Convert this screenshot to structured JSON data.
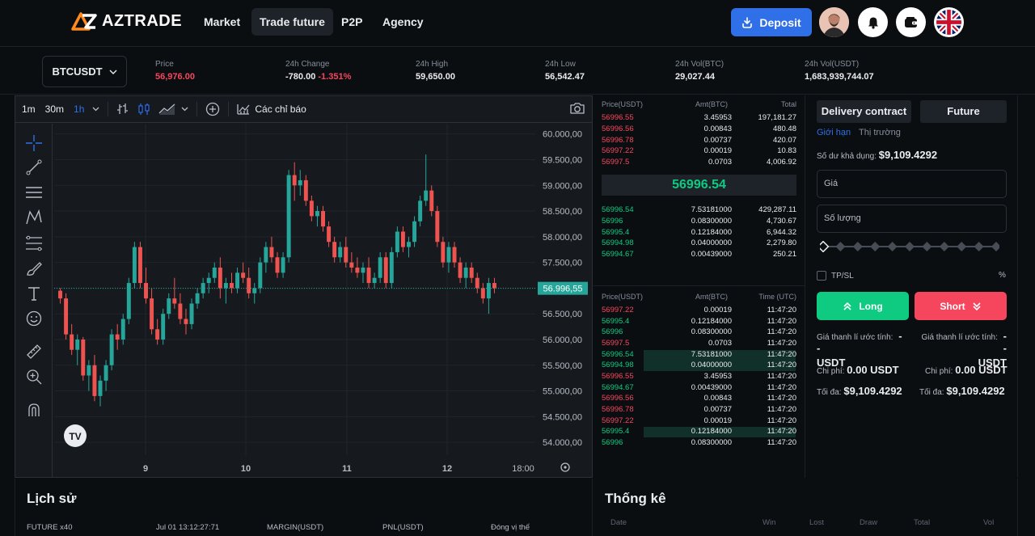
{
  "brand": {
    "name": "AZTRADE"
  },
  "nav": [
    {
      "label": "Market",
      "active": false
    },
    {
      "label": "Trade future",
      "active": true
    },
    {
      "label": "P2P",
      "active": false
    },
    {
      "label": "Agency",
      "active": false
    }
  ],
  "header": {
    "deposit_label": "Deposit",
    "icons": [
      "avatar",
      "bell-icon",
      "wallet-icon",
      "uk-flag-icon"
    ]
  },
  "ticker": {
    "pair": "BTCUSDT",
    "stats": [
      {
        "label": "Price",
        "value": "56,976.00",
        "value_extra": "",
        "color": "red"
      },
      {
        "label": "24h Change",
        "value": "-780.00",
        "value_extra": "-1.351%",
        "color": "white"
      },
      {
        "label": "24h High",
        "value": "59,650.00",
        "value_extra": "",
        "color": "white"
      },
      {
        "label": "24h Low",
        "value": "56,542.47",
        "value_extra": "",
        "color": "white"
      },
      {
        "label": "24h Vol(BTC)",
        "value": "29,027.44",
        "value_extra": "",
        "color": "white"
      },
      {
        "label": "24h Vol(USDT)",
        "value": "1,683,939,744.07",
        "value_extra": "",
        "color": "white"
      }
    ]
  },
  "chart_toolbar": {
    "timeframes": [
      "1m",
      "30m",
      "1h"
    ],
    "active_timeframe": "1h",
    "indicators_label": "Các chỉ báo"
  },
  "chart_data": {
    "type": "candlestick",
    "y_ticks": [
      "60.000,00",
      "59.500,00",
      "59.000,00",
      "58.500,00",
      "58.000,00",
      "57.500,00",
      "57.000,00",
      "56.500,00",
      "56.000,00",
      "55.500,00",
      "55.000,00",
      "54.500,00",
      "54.000,00"
    ],
    "x_ticks": [
      "9",
      "10",
      "11",
      "12",
      "18:00"
    ],
    "ylim": [
      53750,
      60200
    ],
    "last_price_label": "56.996,55",
    "last_price": 56996.55,
    "up_color": "#26a69a",
    "down_color": "#ef5350",
    "candles_ohlc": [
      [
        56950,
        57000,
        56700,
        56800
      ],
      [
        56800,
        56900,
        56000,
        56100
      ],
      [
        56100,
        56300,
        55700,
        55800
      ],
      [
        55800,
        56100,
        55500,
        56000
      ],
      [
        56000,
        56050,
        55200,
        55300
      ],
      [
        55300,
        55600,
        55000,
        55500
      ],
      [
        55500,
        55700,
        54800,
        54900
      ],
      [
        54900,
        55300,
        54700,
        55200
      ],
      [
        55200,
        55600,
        55000,
        55500
      ],
      [
        55500,
        56200,
        55400,
        56100
      ],
      [
        56100,
        56300,
        55800,
        56000
      ],
      [
        56000,
        56500,
        55900,
        56400
      ],
      [
        56400,
        57200,
        56300,
        57100
      ],
      [
        57100,
        57900,
        57000,
        57800
      ],
      [
        57800,
        57900,
        57000,
        57100
      ],
      [
        57100,
        57400,
        56700,
        56800
      ],
      [
        56800,
        57000,
        56100,
        56200
      ],
      [
        56200,
        56400,
        55900,
        56000
      ],
      [
        56000,
        56600,
        55900,
        56500
      ],
      [
        56500,
        56900,
        56400,
        56800
      ],
      [
        56800,
        57200,
        56600,
        56700
      ],
      [
        56700,
        56900,
        56300,
        56400
      ],
      [
        56400,
        56600,
        56100,
        56300
      ],
      [
        56300,
        56800,
        56200,
        56700
      ],
      [
        56700,
        57000,
        56600,
        56900
      ],
      [
        56900,
        57200,
        56800,
        57100
      ],
      [
        57100,
        57300,
        56900,
        57200
      ],
      [
        57200,
        57500,
        57100,
        57400
      ],
      [
        57400,
        57600,
        56800,
        57000
      ],
      [
        57000,
        57200,
        56700,
        57100
      ],
      [
        57100,
        57300,
        56900,
        57000
      ],
      [
        57000,
        57400,
        56900,
        57300
      ],
      [
        57300,
        57500,
        57100,
        57200
      ],
      [
        57200,
        57400,
        56800,
        56900
      ],
      [
        56900,
        57100,
        56700,
        57000
      ],
      [
        57000,
        57600,
        56900,
        57500
      ],
      [
        57500,
        57900,
        57300,
        57800
      ],
      [
        57800,
        58000,
        57500,
        57600
      ],
      [
        57600,
        57700,
        57200,
        57300
      ],
      [
        57300,
        57700,
        57200,
        57600
      ],
      [
        57600,
        59300,
        57500,
        59200
      ],
      [
        59200,
        59450,
        58700,
        59000
      ],
      [
        59000,
        59300,
        58800,
        59100
      ],
      [
        59100,
        59200,
        58600,
        58700
      ],
      [
        58700,
        58800,
        58300,
        58400
      ],
      [
        58400,
        58600,
        58200,
        58500
      ],
      [
        58500,
        58600,
        58100,
        58200
      ],
      [
        58200,
        58300,
        57800,
        57900
      ],
      [
        57900,
        58000,
        57500,
        57600
      ],
      [
        57600,
        57900,
        57500,
        57800
      ],
      [
        57800,
        58000,
        57400,
        57500
      ],
      [
        57500,
        57700,
        57300,
        57400
      ],
      [
        57400,
        57600,
        57200,
        57300
      ],
      [
        57300,
        57500,
        57100,
        57400
      ],
      [
        57400,
        57600,
        57000,
        57100
      ],
      [
        57100,
        57300,
        57000,
        57200
      ],
      [
        57200,
        57700,
        57100,
        57600
      ],
      [
        57600,
        57700,
        57000,
        57100
      ],
      [
        57100,
        57800,
        57000,
        57700
      ],
      [
        57700,
        58200,
        57600,
        58100
      ],
      [
        58100,
        58200,
        57700,
        57800
      ],
      [
        57800,
        58000,
        57600,
        57900
      ],
      [
        57900,
        58400,
        57800,
        58300
      ],
      [
        58300,
        58800,
        58200,
        58700
      ],
      [
        58700,
        59600,
        58600,
        58900
      ],
      [
        58900,
        59000,
        58400,
        58500
      ],
      [
        58500,
        58600,
        57800,
        57900
      ],
      [
        57900,
        58000,
        57400,
        57500
      ],
      [
        57500,
        57900,
        57300,
        57800
      ],
      [
        57800,
        57900,
        57400,
        57500
      ],
      [
        57500,
        57600,
        57100,
        57200
      ],
      [
        57200,
        57500,
        57000,
        57400
      ],
      [
        57400,
        57500,
        57100,
        57200
      ],
      [
        57200,
        57300,
        56900,
        57000
      ],
      [
        57000,
        57100,
        56700,
        56800
      ],
      [
        56800,
        57200,
        56500,
        57100
      ],
      [
        57100,
        57200,
        56900,
        57000
      ]
    ]
  },
  "orderbook": {
    "headers": [
      "Price(USDT)",
      "Amt(BTC)",
      "Total"
    ],
    "asks": [
      [
        "56996.55",
        "3.45953",
        "197,181.27"
      ],
      [
        "56996.56",
        "0.00843",
        "480.48"
      ],
      [
        "56996.78",
        "0.00737",
        "420.07"
      ],
      [
        "56997.22",
        "0.00019",
        "10.83"
      ],
      [
        "56997.5",
        "0.0703",
        "4,006.92"
      ]
    ],
    "mid_price": "56996.54",
    "bids": [
      [
        "56996.54",
        "7.53181000",
        "429,287.11"
      ],
      [
        "56996",
        "0.08300000",
        "4,730.67"
      ],
      [
        "56995.4",
        "0.12184000",
        "6,944.32"
      ],
      [
        "56994.98",
        "0.04000000",
        "2,279.80"
      ],
      [
        "56994.67",
        "0.00439000",
        "250.21"
      ]
    ]
  },
  "trades": {
    "headers": [
      "Price(USDT)",
      "Amt(BTC)",
      "Time (UTC)"
    ],
    "rows": [
      {
        "price": "56997.22",
        "amount": "0.00019",
        "time": "11:47:20",
        "side": "sell",
        "highlight": false
      },
      {
        "price": "56995.4",
        "amount": "0.12184000",
        "time": "11:47:20",
        "side": "buy",
        "highlight": false
      },
      {
        "price": "56996",
        "amount": "0.08300000",
        "time": "11:47:20",
        "side": "buy",
        "highlight": false
      },
      {
        "price": "56997.5",
        "amount": "0.0703",
        "time": "11:47:20",
        "side": "sell",
        "highlight": false
      },
      {
        "price": "56996.54",
        "amount": "7.53181000",
        "time": "11:47:20",
        "side": "buy",
        "highlight": true
      },
      {
        "price": "56994.98",
        "amount": "0.04000000",
        "time": "11:47:20",
        "side": "buy",
        "highlight": true
      },
      {
        "price": "56996.55",
        "amount": "3.45953",
        "time": "11:47:20",
        "side": "sell",
        "highlight": false
      },
      {
        "price": "56994.67",
        "amount": "0.00439000",
        "time": "11:47:20",
        "side": "buy",
        "highlight": false
      },
      {
        "price": "56996.56",
        "amount": "0.00843",
        "time": "11:47:20",
        "side": "sell",
        "highlight": false
      },
      {
        "price": "56996.78",
        "amount": "0.00737",
        "time": "11:47:20",
        "side": "sell",
        "highlight": false
      },
      {
        "price": "56997.22",
        "amount": "0.00019",
        "time": "11:47:20",
        "side": "sell",
        "highlight": false
      },
      {
        "price": "56995.4",
        "amount": "0.12184000",
        "time": "11:47:20",
        "side": "buy",
        "highlight": true
      },
      {
        "price": "56996",
        "amount": "0.08300000",
        "time": "11:47:20",
        "side": "buy",
        "highlight": false
      }
    ]
  },
  "trade_form": {
    "tabs": [
      "Delivery contract",
      "Future"
    ],
    "order_types": [
      "Giới hạn",
      "Thị trường"
    ],
    "available_label": "Số dư khả dụng:",
    "available_value": "$9,109.4292",
    "price_placeholder": "Giá",
    "qty_placeholder": "Số lượng",
    "tpsl_label": "TP/SL",
    "percent_sign": "%",
    "long_label": "Long",
    "short_label": "Short",
    "liq_label": "Giá thanh lí ước tính:",
    "liq_value": "--",
    "liq_unit": "USDT",
    "fee_label": "Chi phí:",
    "fee_value": "0.00 USDT",
    "max_label": "Tối đa:",
    "max_value": "$9,109.4292"
  },
  "history": {
    "title": "Lịch sử",
    "columns": [
      "FUTURE x40",
      "Jul 01 13:12:27:71",
      "MARGIN(USDT)",
      "PNL(USDT)",
      "Đóng vị thế"
    ]
  },
  "statistics": {
    "title": "Thống kê",
    "columns": [
      "Date",
      "Win",
      "Lost",
      "Draw",
      "Total",
      "Vol"
    ]
  }
}
